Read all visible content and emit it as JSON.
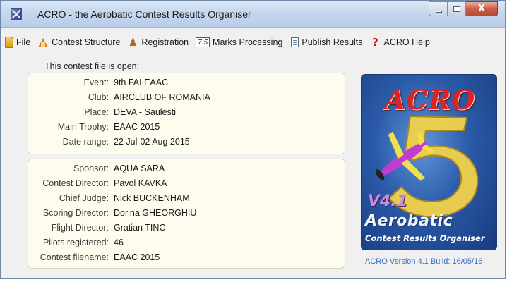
{
  "window": {
    "title": "ACRO - the Aerobatic Contest Results Organiser",
    "controls": {
      "minimize": "",
      "maximize": "",
      "close": "X"
    }
  },
  "menu": [
    {
      "label": "File",
      "icon": "folder-icon"
    },
    {
      "label": "Contest Structure",
      "icon": "structure-icon"
    },
    {
      "label": "Registration",
      "icon": "registration-icon"
    },
    {
      "label": "Marks Processing",
      "icon": "marks-icon",
      "icon_text": "7.5"
    },
    {
      "label": "Publish Results",
      "icon": "document-icon"
    },
    {
      "label": "ACRO Help",
      "icon": "help-icon",
      "icon_text": "?"
    }
  ],
  "open_label": "This contest file is open:",
  "event_info": [
    {
      "label": "Event:",
      "value": "9th FAI EAAC"
    },
    {
      "label": "Club:",
      "value": "AIRCLUB OF ROMANIA"
    },
    {
      "label": "Place:",
      "value": "DEVA - Saulesti"
    },
    {
      "label": "Main Trophy:",
      "value": "EAAC 2015"
    },
    {
      "label": "Date range:",
      "value": "22 Jul-02 Aug 2015"
    }
  ],
  "staff_info": [
    {
      "label": "Sponsor:",
      "value": "AQUA SARA"
    },
    {
      "label": "Contest Director:",
      "value": "Pavol KAVKA"
    },
    {
      "label": "Chief Judge:",
      "value": "Nick BUCKENHAM"
    },
    {
      "label": "Scoring Director:",
      "value": "Dorina GHEORGHIU"
    },
    {
      "label": "Flight Director:",
      "value": "Gratian TINC"
    },
    {
      "label": "Pilots registered:",
      "value": "46"
    },
    {
      "label": "Contest filename:",
      "value": "EAAC 2015"
    }
  ],
  "logo": {
    "title": "ACRO",
    "version": "V4.1",
    "word": "Aerobatic",
    "subtitle": "Contest Results Organiser"
  },
  "version_line": "ACRO Version 4.1 Build: 16/05/16"
}
